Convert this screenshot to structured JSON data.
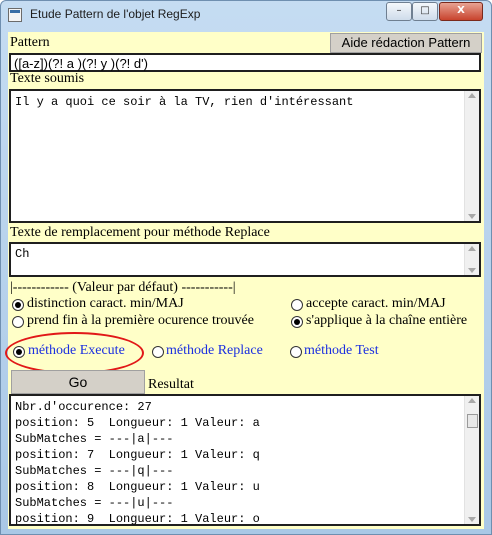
{
  "window": {
    "title": "Etude Pattern de l'objet RegExp",
    "controls": {
      "minimize": "–",
      "maximize": "□",
      "close": "X"
    }
  },
  "pattern": {
    "label": "Pattern",
    "value": "([a-z])(?! a )(?! y )(?! d')",
    "help_button": "Aide rédaction Pattern"
  },
  "subject": {
    "label": "Texte soumis",
    "value": "Il y a quoi ce soir à la TV, rien d'intéressant"
  },
  "replace": {
    "label": "Texte de remplacement pour méthode Replace",
    "value": "Ch"
  },
  "options": {
    "default_header": "|------------ (Valeur par défaut) -----------|",
    "case_sensitive": "distinction caract. min/MAJ",
    "case_insensitive": "accepte caract. min/MAJ",
    "first_only": "prend fin à la première ocurence trouvée",
    "global": "s'applique à la chaîne entière"
  },
  "methods": {
    "execute": "méthode Execute",
    "replace": "méthode Replace",
    "test": "méthode Test",
    "selected": "execute"
  },
  "actions": {
    "go": "Go"
  },
  "result": {
    "label": "Resultat",
    "lines": [
      "Nbr.d'occurence: 27",
      "position: 5  Longueur: 1 Valeur: a",
      "SubMatches = ---|a|---",
      "position: 7  Longueur: 1 Valeur: q",
      "SubMatches = ---|q|---",
      "position: 8  Longueur: 1 Valeur: u",
      "SubMatches = ---|u|---",
      "position: 9  Longueur: 1 Valeur: o"
    ]
  },
  "colors": {
    "panel": "#ffffc8",
    "method_text": "#1b2fe0",
    "annotation": "#e11818"
  }
}
